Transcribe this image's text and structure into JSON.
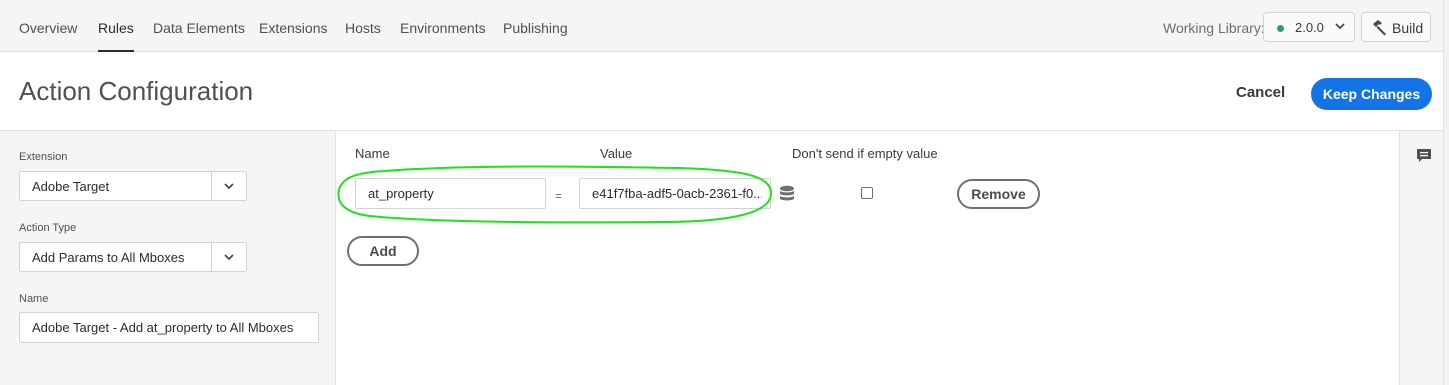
{
  "nav": {
    "tabs": [
      {
        "label": "Overview"
      },
      {
        "label": "Rules",
        "active": true
      },
      {
        "label": "Data Elements"
      },
      {
        "label": "Extensions"
      },
      {
        "label": "Hosts"
      },
      {
        "label": "Environments"
      },
      {
        "label": "Publishing"
      }
    ],
    "working_library_label": "Working Library:",
    "library_version": "2.0.0",
    "library_status_color": "#2d9d78",
    "build_label": "Build",
    "build_icon": "hammer-icon"
  },
  "header": {
    "title": "Action Configuration",
    "cancel_label": "Cancel",
    "keep_label": "Keep Changes",
    "accent_color": "#1473e6"
  },
  "left": {
    "extension_label": "Extension",
    "extension_value": "Adobe Target",
    "action_type_label": "Action Type",
    "action_type_value": "Add Params to All Mboxes",
    "name_label": "Name",
    "name_value": "Adobe Target - Add at_property to All Mboxes"
  },
  "params": {
    "name_header": "Name",
    "value_header": "Value",
    "empty_header": "Don't send if empty value",
    "rows": [
      {
        "name": "at_property",
        "equals": "=",
        "value": "e41f7fba-adf5-0acb-2361-f0...",
        "dont_send_if_empty": false,
        "remove_label": "Remove"
      }
    ],
    "add_label": "Add",
    "data_element_icon": "database-icon",
    "highlight_color": "#22e01a"
  },
  "rail": {
    "icon": "comment-icon"
  }
}
